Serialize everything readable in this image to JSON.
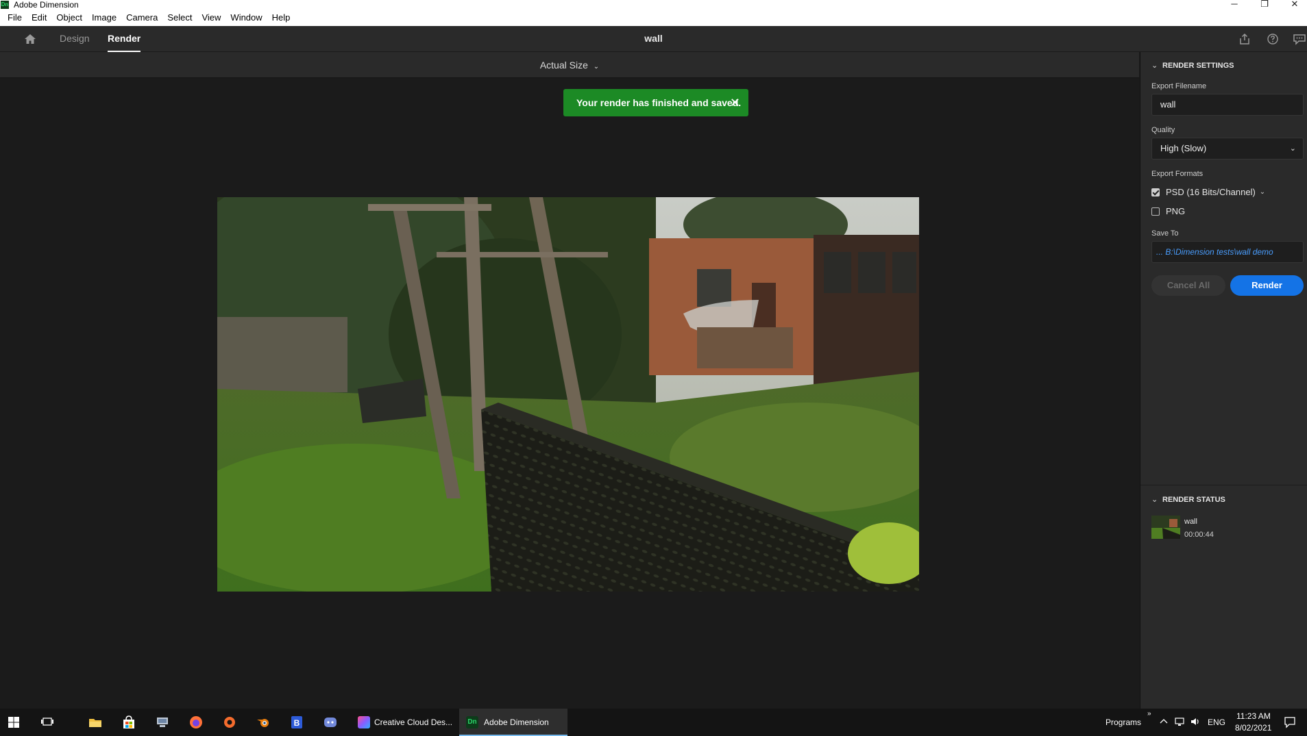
{
  "window": {
    "app_title": "Adobe Dimension",
    "logo_text": "Dn",
    "minimize": "─",
    "restore": "❐",
    "close": "✕"
  },
  "menu": {
    "items": [
      "File",
      "Edit",
      "Object",
      "Image",
      "Camera",
      "Select",
      "View",
      "Window",
      "Help"
    ]
  },
  "appbar": {
    "tabs": [
      {
        "label": "Design",
        "active": false
      },
      {
        "label": "Render",
        "active": true
      }
    ],
    "document_title": "wall",
    "icons": [
      "home-icon",
      "share-icon",
      "help-icon",
      "feedback-icon"
    ]
  },
  "viewbar": {
    "zoom_label": "Actual Size"
  },
  "toast": {
    "message": "Your render has finished and saved.",
    "close": "✕"
  },
  "render_settings": {
    "header": "RENDER SETTINGS",
    "export_filename_label": "Export Filename",
    "export_filename_value": "wall",
    "quality_label": "Quality",
    "quality_value": "High (Slow)",
    "export_formats_label": "Export Formats",
    "formats": [
      {
        "label": "PSD (16 Bits/Channel)",
        "checked": true
      },
      {
        "label": "PNG",
        "checked": false
      }
    ],
    "save_to_label": "Save To",
    "save_to_value": "... B:\\Dimension tests\\wall demo",
    "cancel_all_label": "Cancel All",
    "render_label": "Render"
  },
  "render_status": {
    "header": "RENDER STATUS",
    "items": [
      {
        "name": "wall",
        "time": "00:00:44"
      }
    ]
  },
  "taskbar": {
    "apps": [
      {
        "label": "Creative Cloud Des...",
        "active": false
      },
      {
        "label": "Adobe Dimension",
        "active": true
      }
    ],
    "app_icon_text": "Dn",
    "programs_label": "Programs",
    "programs_chevron": "»",
    "language": "ENG",
    "time": "11:23 AM",
    "date": "8/02/2021"
  },
  "colors": {
    "accent_blue": "#1473e6",
    "toast_green": "#1c8a25",
    "link_blue": "#4a9eff"
  }
}
